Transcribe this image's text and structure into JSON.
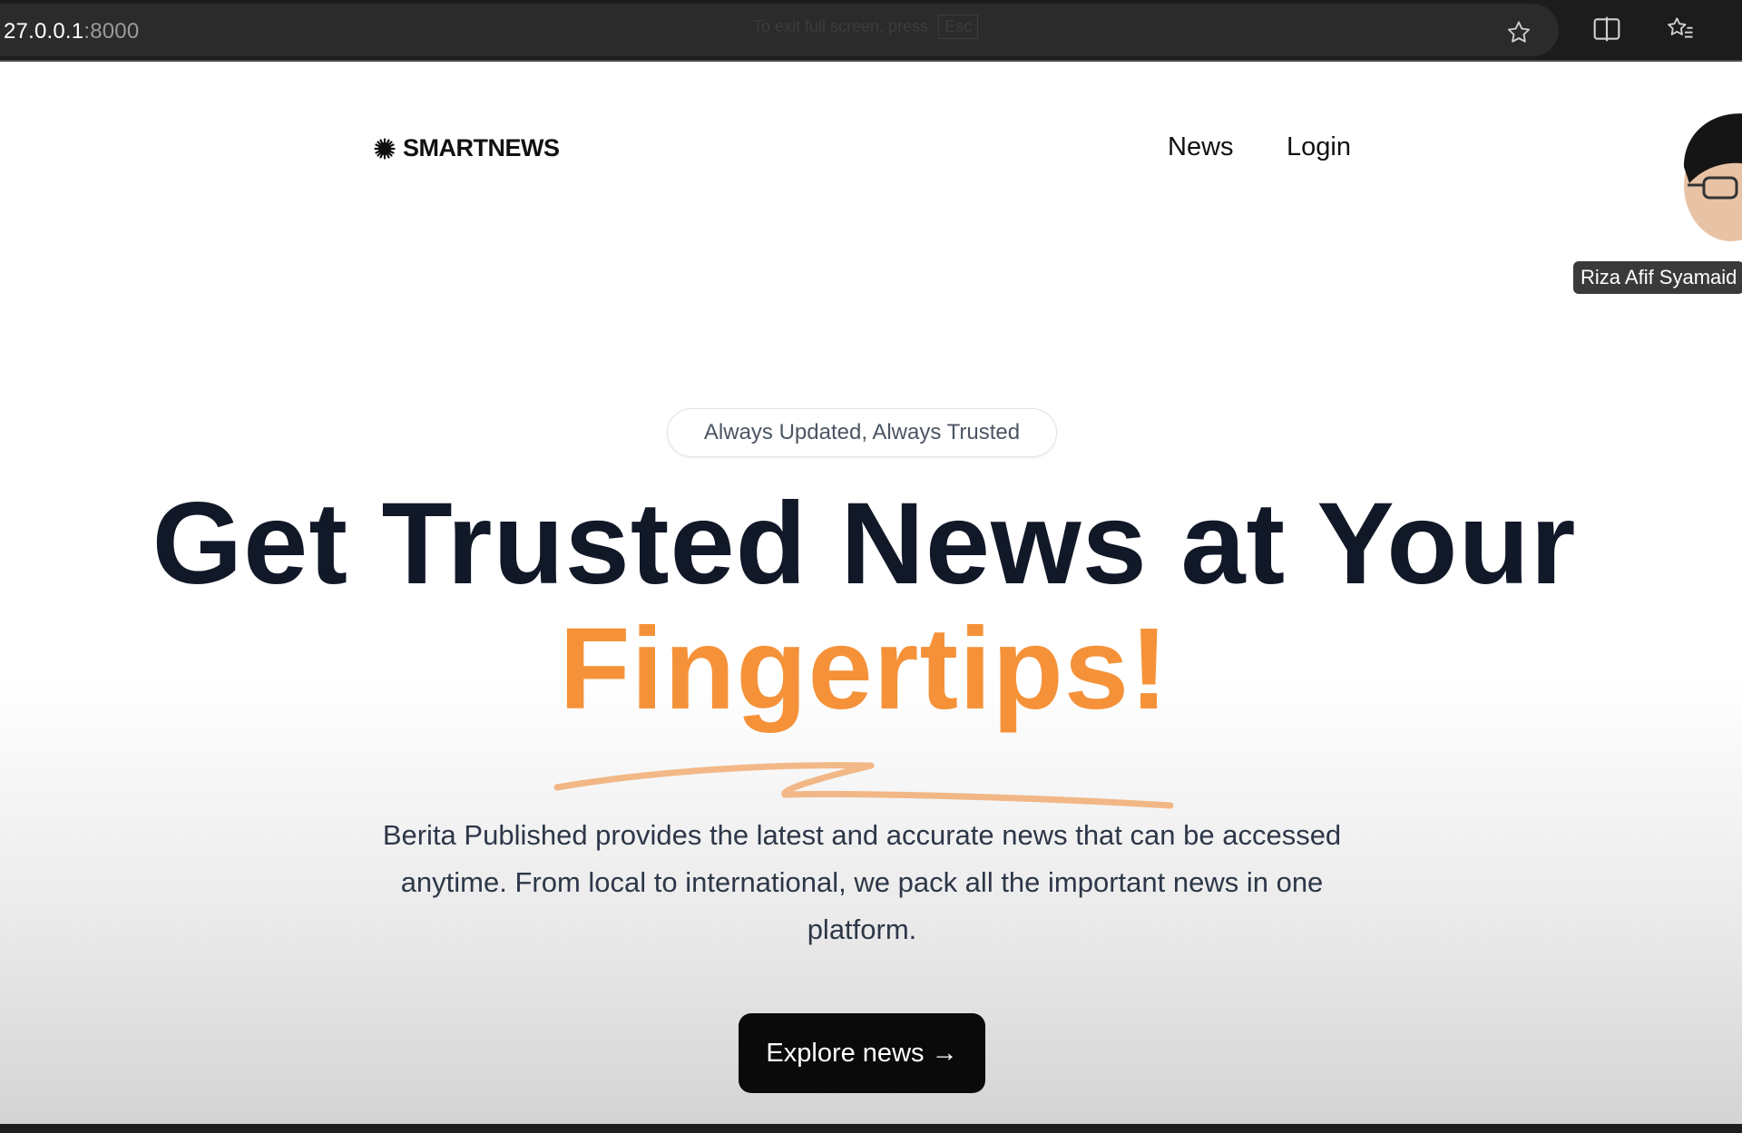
{
  "browser": {
    "url_host": "27.0.0.1",
    "url_port": ":8000",
    "fullscreen_hint": "To exit full screen, press",
    "fullscreen_key": "Esc",
    "icons": [
      "star-icon",
      "split-screen-icon",
      "favorites-icon"
    ]
  },
  "nav": {
    "logo_text": "SMARTNEWS",
    "items": [
      {
        "label": "News"
      },
      {
        "label": "Login"
      }
    ]
  },
  "webcam": {
    "name": "Riza Afif Syamaid"
  },
  "hero": {
    "badge": "Always Updated, Always Trusted",
    "headline_line1": "Get Trusted News at Your",
    "headline_line2": "Fingertips!",
    "accent_color": "#f59239",
    "description": "Berita Published provides the latest and accurate news that can be accessed anytime. From local to international, we pack all the important news in one platform.",
    "cta_label": "Explore news →"
  }
}
